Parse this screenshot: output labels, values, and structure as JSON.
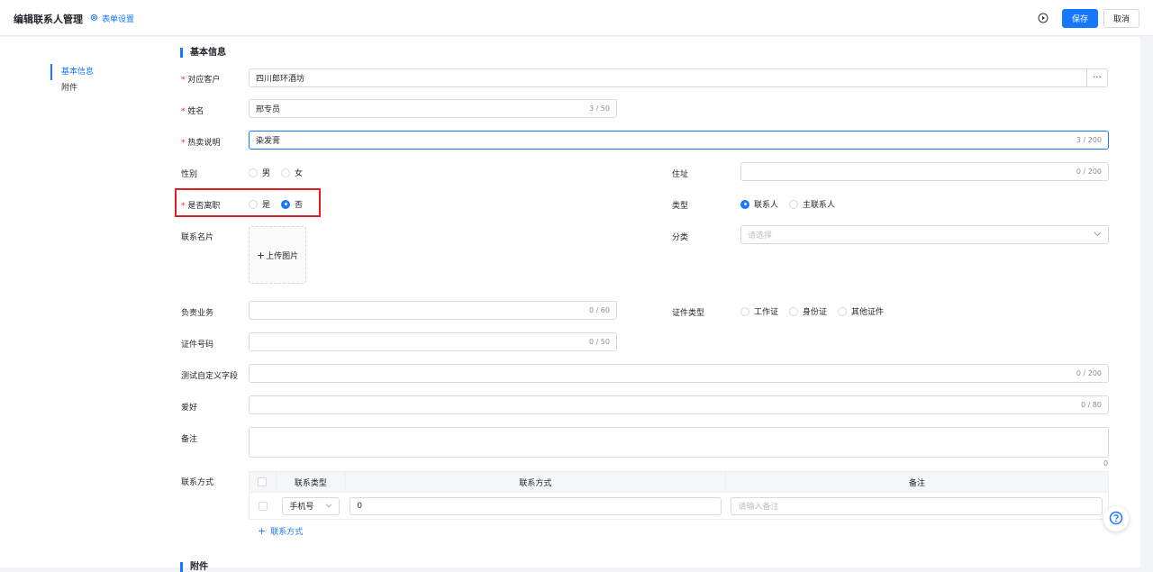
{
  "header": {
    "title": "编辑联系人管理",
    "form_settings": "表单设置",
    "save_label": "保存",
    "cancel_label": "取消"
  },
  "sidebar": {
    "items": [
      {
        "label": "基本信息",
        "active": true
      },
      {
        "label": "附件",
        "active": false
      }
    ]
  },
  "section_basic": "基本信息",
  "section_attach": "附件",
  "fields": {
    "customer": {
      "label": "对应客户",
      "value": "四川郎环酒坊"
    },
    "name": {
      "label": "姓名",
      "value": "邢专员",
      "count": "3 / 50"
    },
    "hot_desc": {
      "label": "热卖说明",
      "value": "染发膏",
      "count": "3 / 200"
    },
    "gender": {
      "label": "性别",
      "options": [
        "男",
        "女"
      ],
      "selected": null
    },
    "address": {
      "label": "住址",
      "count": "0 / 200"
    },
    "resigned": {
      "label": "是否离职",
      "options": [
        "是",
        "否"
      ],
      "selected": "否"
    },
    "type": {
      "label": "类型",
      "options": [
        "联系人",
        "主联系人"
      ],
      "selected": "联系人"
    },
    "business_card": {
      "label": "联系名片",
      "upload_label": "上传图片"
    },
    "category": {
      "label": "分类",
      "placeholder": "请选择"
    },
    "business": {
      "label": "负责业务",
      "count": "0 / 60"
    },
    "id_type": {
      "label": "证件类型",
      "options": [
        "工作证",
        "身份证",
        "其他证件"
      ],
      "selected": null
    },
    "id_number": {
      "label": "证件号码",
      "count": "0 / 50"
    },
    "custom_field": {
      "label": "测试自定义字段",
      "count": "0 / 200"
    },
    "hobby": {
      "label": "爱好",
      "count": "0 / 80"
    },
    "remark": {
      "label": "备注",
      "count": "0"
    },
    "contact": {
      "label": "联系方式"
    }
  },
  "contact_table": {
    "headers": [
      "联系类型",
      "联系方式",
      "备注"
    ],
    "rows": [
      {
        "type": "手机号",
        "value": "0",
        "remark_placeholder": "请输入备注"
      }
    ],
    "add_label": "联系方式"
  },
  "colors": {
    "primary": "#1677ff",
    "required": "#f5222d",
    "highlight": "#e02020"
  }
}
